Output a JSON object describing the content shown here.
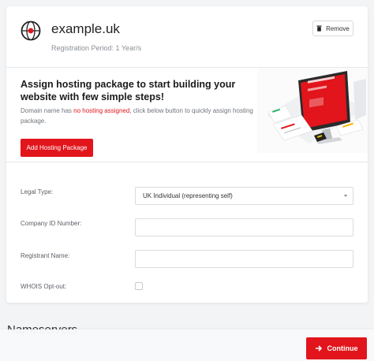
{
  "domain": {
    "name": "example.uk",
    "registration_period": "Registration Period: 1 Year/s",
    "icon": "globe-icon",
    "remove_label": "Remove"
  },
  "hosting": {
    "title": "Assign hosting package to start building your website with few simple steps!",
    "desc_prefix": "Domain name has ",
    "desc_highlight": "no hosting assigned",
    "desc_suffix": ", click below button to quickly assign hosting package.",
    "button_label": "Add Hosting Package"
  },
  "form": {
    "legal_type_label": "Legal Type:",
    "legal_type_value": "UK Individual (representing self)",
    "company_id_label": "Company ID Number:",
    "company_id_value": "",
    "registrant_label": "Registrant Name:",
    "registrant_value": "",
    "whois_label": "WHOIS Opt-out:",
    "whois_checked": false
  },
  "nameservers_heading": "Nameservers",
  "footer": {
    "continue_label": "Continue"
  },
  "colors": {
    "accent": "#e1151b",
    "background": "#f3f4f6"
  }
}
